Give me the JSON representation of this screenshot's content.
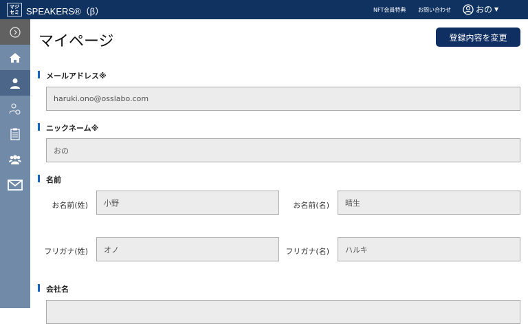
{
  "header": {
    "logo_text": "マジセミ",
    "brand": "SPEAKERS®（β）",
    "nav": [
      "NFT会員特典",
      "お問い合わせ"
    ],
    "user_name": "おの"
  },
  "page": {
    "title": "マイページ",
    "update_button": "登録内容を変更"
  },
  "sections": {
    "email": {
      "label": "メールアドレス※",
      "value": "haruki.ono@osslabo.com"
    },
    "nickname": {
      "label": "ニックネーム※",
      "value": "おの"
    },
    "name": {
      "label": "名前",
      "last_label": "お名前(姓)",
      "last_value": "小野",
      "first_label": "お名前(名)",
      "first_value": "晴生",
      "last_kana_label": "フリガナ(姓)",
      "last_kana_value": "オノ",
      "first_kana_label": "フリガナ(名)",
      "first_kana_value": "ハルキ"
    },
    "company": {
      "label": "会社名",
      "value": ""
    }
  }
}
